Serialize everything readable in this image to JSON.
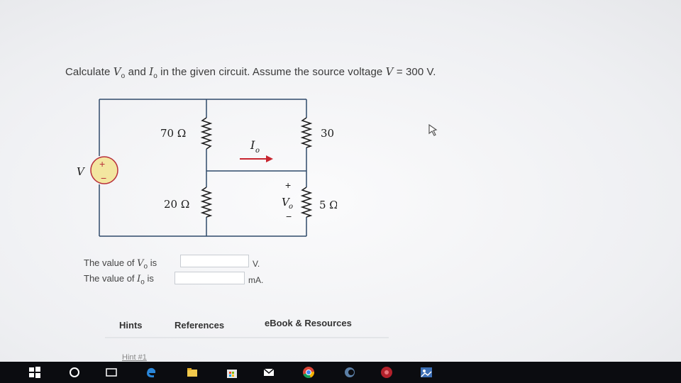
{
  "question": {
    "prefix": "Calculate ",
    "v_sym": "V",
    "sub_o": "o",
    "mid": " and ",
    "i_sym": "I",
    "suffix": " in the given circuit. Assume the source voltage ",
    "v_src": "V",
    "value": " = 300 V."
  },
  "circuit": {
    "r1": "70 Ω",
    "r2": "30 Ω",
    "r3": "20 Ω",
    "r4": "5 Ω",
    "source_label": "V",
    "current_label": "I",
    "current_sub": "o",
    "voltage_label": "V",
    "voltage_sub": "o",
    "plus": "+",
    "minus": "−"
  },
  "answers": {
    "vo_prefix": "The value of ",
    "vo_sym": "V",
    "vo_sub": "o",
    "vo_suffix": " is",
    "vo_value": "",
    "vo_unit": "V.",
    "io_prefix": "The value of ",
    "io_sym": "I",
    "io_sub": "o",
    "io_suffix": " is",
    "io_value": "",
    "io_unit": "mA."
  },
  "tabs": {
    "hints": "Hints",
    "references": "References",
    "ebook": "eBook & Resources"
  },
  "hint_link": "Hint #1",
  "taskbar": {
    "icons": [
      "windows-start-icon",
      "cortana-search-icon",
      "task-view-icon",
      "edge-icon",
      "file-explorer-icon",
      "store-icon",
      "mail-icon",
      "chrome-icon",
      "app-icon",
      "record-icon",
      "photos-icon"
    ]
  }
}
